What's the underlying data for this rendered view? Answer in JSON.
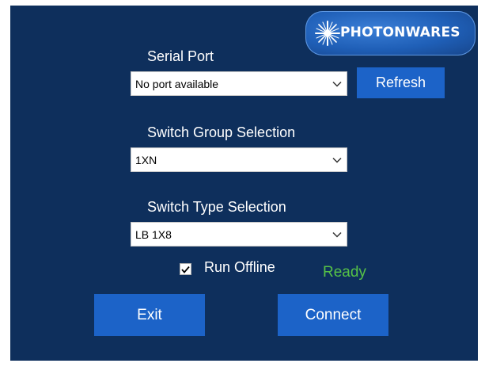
{
  "logo": {
    "text": "PHOTONWARES",
    "icon": "starburst-icon"
  },
  "serial_port": {
    "label": "Serial Port",
    "selected": "No port available",
    "refresh_label": "Refresh"
  },
  "switch_group": {
    "label": "Switch Group Selection",
    "selected": "1XN"
  },
  "switch_type": {
    "label": "Switch Type Selection",
    "selected": "LB 1X8"
  },
  "run_offline": {
    "label": "Run Offline",
    "checked": true
  },
  "status": {
    "text": "Ready",
    "color": "#56c247"
  },
  "buttons": {
    "exit_label": "Exit",
    "connect_label": "Connect"
  },
  "colors": {
    "background": "#0e2f5c",
    "button": "#1c63c8"
  }
}
